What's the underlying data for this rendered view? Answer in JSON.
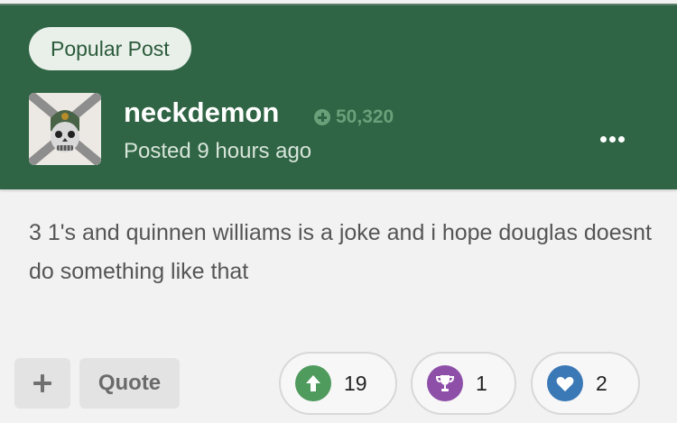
{
  "post": {
    "badge": "Popular Post",
    "author": "neckdemon",
    "reputation": "50,320",
    "posted": "Posted 9 hours ago",
    "content": "3 1's and quinnen williams is a joke and i hope douglas doesnt do something like that"
  },
  "actions": {
    "quote_label": "Quote"
  },
  "reactions": [
    {
      "icon": "upvote-arrow-icon",
      "count": "19",
      "color": "#4f9a5d"
    },
    {
      "icon": "trophy-icon",
      "count": "1",
      "color": "#8e4fa8"
    },
    {
      "icon": "heart-icon",
      "count": "2",
      "color": "#3b78b6"
    }
  ]
}
